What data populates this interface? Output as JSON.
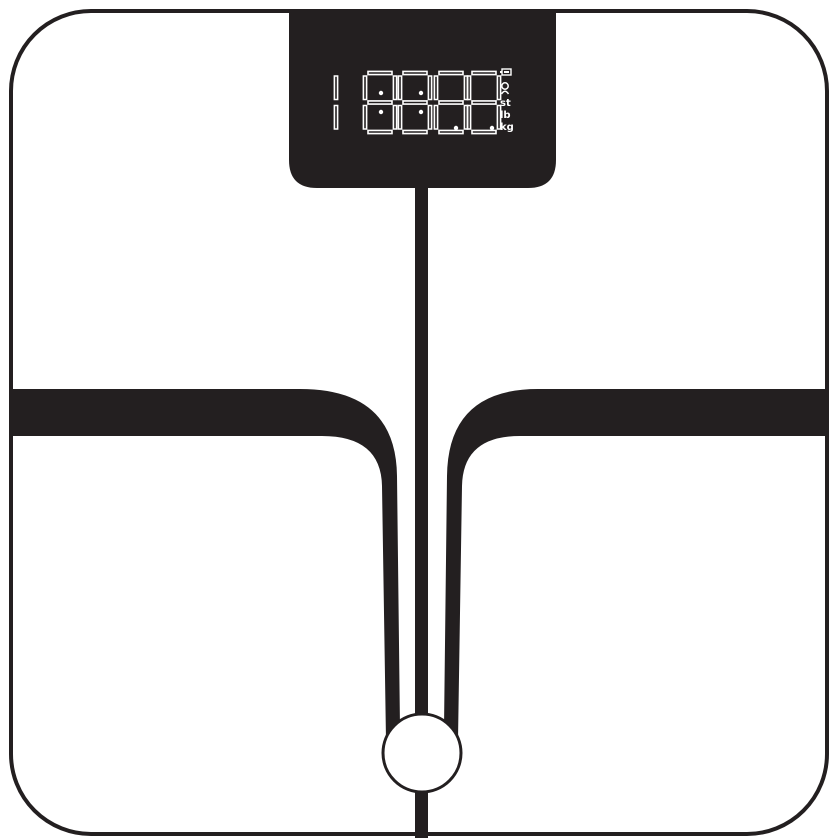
{
  "colors": {
    "body": "#ffffff",
    "outline": "#231f20",
    "electrode": "#231f20",
    "display_panel": "#231f20",
    "display_segments": "#ffffff"
  },
  "display": {
    "digits": "18888",
    "icons": [
      "battery-icon",
      "user-icon"
    ],
    "units": [
      "st",
      "lb",
      "kg"
    ]
  }
}
